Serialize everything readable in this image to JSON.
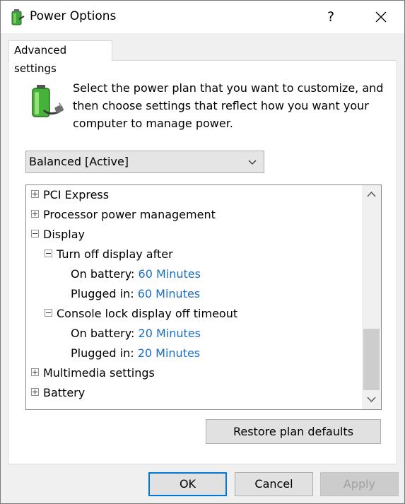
{
  "window": {
    "title": "Power Options",
    "help_label": "?",
    "close_label": "close"
  },
  "tab": {
    "label": "Advanced settings"
  },
  "description": "Select the power plan that you want to customize, and then choose settings that reflect how you want your computer to manage power.",
  "plan_select": {
    "value": "Balanced [Active]"
  },
  "tree": {
    "pci_express": "PCI Express",
    "processor": "Processor power management",
    "display": "Display",
    "turn_off_display": {
      "label": "Turn off display after",
      "on_battery_label": "On battery:",
      "on_battery_value": "60 Minutes",
      "plugged_in_label": "Plugged in:",
      "plugged_in_value": "60 Minutes"
    },
    "console_lock": {
      "label": "Console lock display off timeout",
      "on_battery_label": "On battery:",
      "on_battery_value": "20 Minutes",
      "plugged_in_label": "Plugged in:",
      "plugged_in_value": "20 Minutes"
    },
    "multimedia": "Multimedia settings",
    "battery": "Battery"
  },
  "restore_label": "Restore plan defaults",
  "buttons": {
    "ok": "OK",
    "cancel": "Cancel",
    "apply": "Apply"
  },
  "colors": {
    "value_link": "#1a6fc4",
    "focus_border": "#0078d7"
  },
  "icons": {
    "app": "power-options-icon",
    "battery": "battery-plug-icon",
    "expand": "plus-box-icon",
    "collapse": "minus-box-icon"
  }
}
